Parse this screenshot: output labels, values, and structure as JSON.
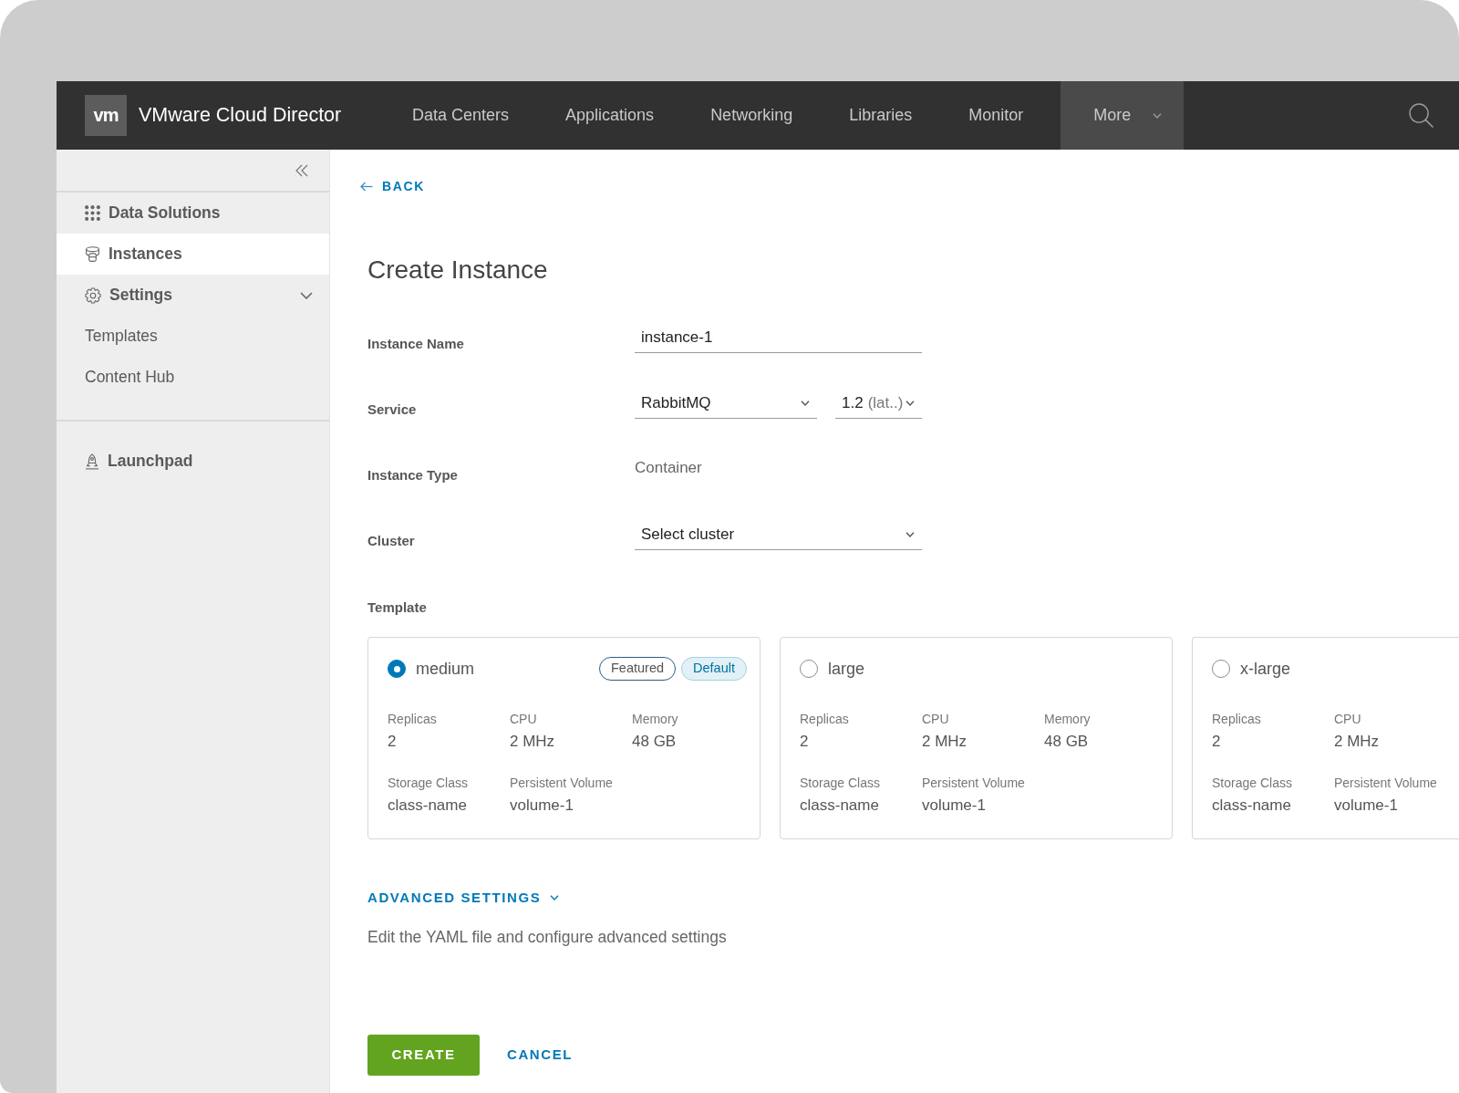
{
  "header": {
    "logo_text": "vm",
    "title": "VMware Cloud Director",
    "nav": [
      {
        "label": "Data Centers",
        "kind": "link",
        "selected": false
      },
      {
        "label": "Applications",
        "kind": "link",
        "selected": false
      },
      {
        "label": "Networking",
        "kind": "link",
        "selected": false
      },
      {
        "label": "Libraries",
        "kind": "link",
        "selected": false
      },
      {
        "label": "Monitor",
        "kind": "link",
        "selected": false
      },
      {
        "label": "More",
        "kind": "dropdown",
        "selected": true
      }
    ]
  },
  "sidebar": {
    "sections": [
      {
        "items": [
          {
            "label": "Data Solutions",
            "selected": false
          },
          {
            "label": "Instances",
            "selected": true
          },
          {
            "label": "Settings",
            "selected": false,
            "expanded": true,
            "children": [
              {
                "label": "Templates",
                "selected": false
              },
              {
                "label": "Content Hub",
                "selected": false
              }
            ]
          }
        ]
      },
      {
        "items": [
          {
            "label": "Launchpad",
            "selected": false
          }
        ]
      }
    ]
  },
  "page": {
    "back": "BACK",
    "title": "Create Instance",
    "fields": [
      {
        "label": "Instance Name",
        "kind": "input",
        "value": "instance-1"
      },
      {
        "label": "Service",
        "kind": "select-pair",
        "selects": [
          {
            "value": "RabbitMQ"
          },
          {
            "value": "1.2",
            "suffix": "(lat..)"
          }
        ]
      },
      {
        "label": "Instance Type",
        "kind": "text",
        "value": "Container"
      },
      {
        "label": "Cluster",
        "kind": "select",
        "placeholder": "Select cluster"
      }
    ],
    "template_label": "Template",
    "templates": [
      {
        "name": "medium",
        "selected": true,
        "badges": [
          {
            "label": "Featured",
            "kind": "outline"
          },
          {
            "label": "Default",
            "kind": "filled"
          }
        ],
        "specs": [
          [
            {
              "label": "Replicas",
              "value": "2"
            },
            {
              "label": "CPU",
              "value": "2 MHz"
            },
            {
              "label": "Memory",
              "value": "48 GB"
            }
          ],
          [
            {
              "label": "Storage Class",
              "value": "class-name"
            },
            {
              "label": "Persistent Volume",
              "value": "volume-1"
            }
          ]
        ]
      },
      {
        "name": "large",
        "selected": false,
        "specs": [
          [
            {
              "label": "Replicas",
              "value": "2"
            },
            {
              "label": "CPU",
              "value": "2 MHz"
            },
            {
              "label": "Memory",
              "value": "48 GB"
            }
          ],
          [
            {
              "label": "Storage Class",
              "value": "class-name"
            },
            {
              "label": "Persistent Volume",
              "value": "volume-1"
            }
          ]
        ]
      },
      {
        "name": "x-large",
        "selected": false,
        "specs": [
          [
            {
              "label": "Replicas",
              "value": "2"
            },
            {
              "label": "CPU",
              "value": "2 MHz"
            }
          ],
          [
            {
              "label": "Storage Class",
              "value": "class-name"
            },
            {
              "label": "Persistent Volume",
              "value": "volume-1"
            }
          ]
        ]
      }
    ],
    "advanced": {
      "label": "ADVANCED SETTINGS",
      "description": "Edit the YAML file and configure advanced settings"
    },
    "buttons": [
      {
        "label": "CREATE",
        "kind": "primary"
      },
      {
        "label": "CANCEL",
        "kind": "link"
      }
    ]
  }
}
